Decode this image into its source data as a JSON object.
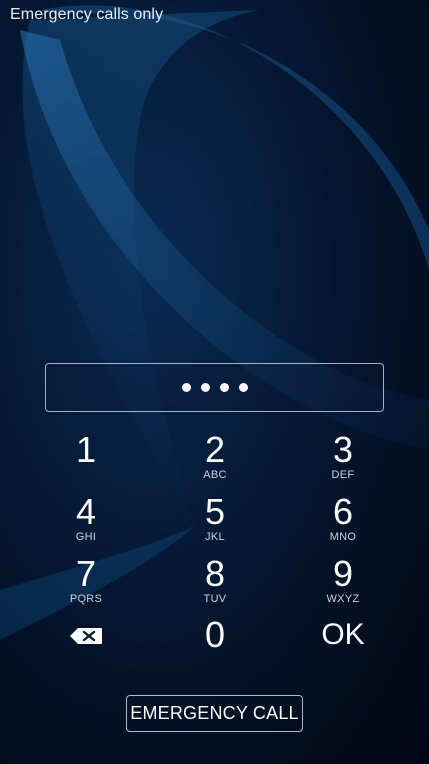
{
  "status_bar": {
    "carrier_text": "Emergency calls only"
  },
  "pin": {
    "entered_count": 4
  },
  "keypad": {
    "keys": [
      {
        "digit": "1",
        "letters": ""
      },
      {
        "digit": "2",
        "letters": "ABC"
      },
      {
        "digit": "3",
        "letters": "DEF"
      },
      {
        "digit": "4",
        "letters": "GHI"
      },
      {
        "digit": "5",
        "letters": "JKL"
      },
      {
        "digit": "6",
        "letters": "MNO"
      },
      {
        "digit": "7",
        "letters": "PQRS"
      },
      {
        "digit": "8",
        "letters": "TUV"
      },
      {
        "digit": "9",
        "letters": "WXYZ"
      },
      {
        "digit": "0",
        "letters": ""
      }
    ],
    "ok_label": "OK",
    "backspace_icon": "backspace-icon"
  },
  "emergency_call_label": "EMERGENCY CALL",
  "colors": {
    "background": "#020c1c",
    "accent": "#1e6fb0"
  }
}
